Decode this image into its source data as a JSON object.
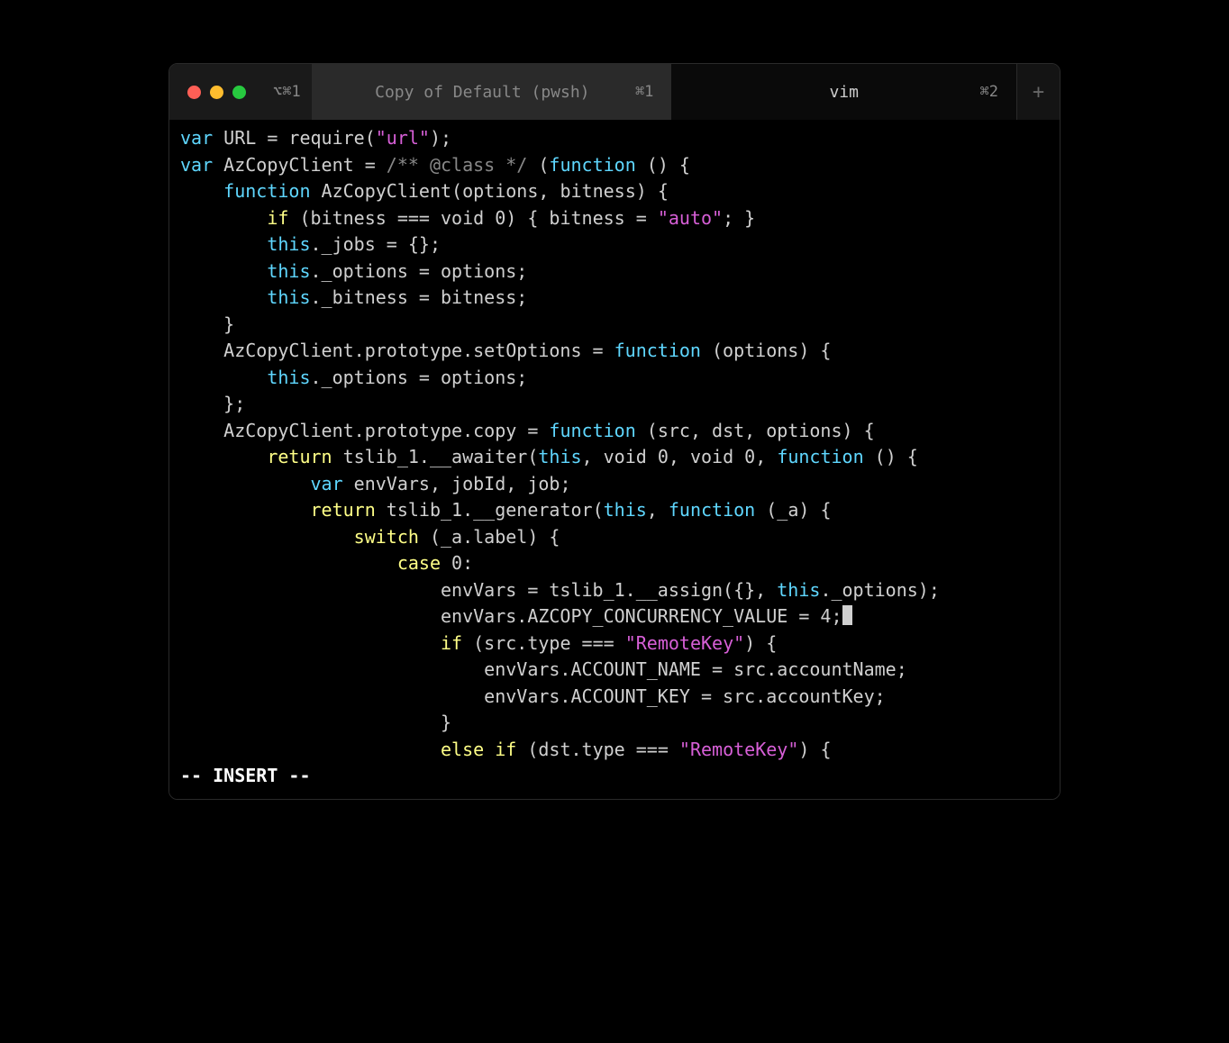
{
  "titlebar": {
    "shortcut_prefix": "⌥⌘1",
    "tabs": [
      {
        "label": "Copy of Default (pwsh)",
        "shortcut": "⌘1",
        "active": true
      },
      {
        "label": "vim",
        "shortcut": "⌘2",
        "active": false
      }
    ],
    "new_tab_symbol": "+"
  },
  "code": {
    "lines": [
      [
        {
          "t": "var",
          "c": "kw-var"
        },
        {
          "t": " URL = require(",
          "c": "ident"
        },
        {
          "t": "\"url\"",
          "c": "str"
        },
        {
          "t": ");",
          "c": "punct"
        }
      ],
      [
        {
          "t": "var",
          "c": "kw-var"
        },
        {
          "t": " AzCopyClient = ",
          "c": "ident"
        },
        {
          "t": "/** @class */",
          "c": "comment"
        },
        {
          "t": " (",
          "c": "punct"
        },
        {
          "t": "function",
          "c": "kw-func"
        },
        {
          "t": " () {",
          "c": "punct"
        }
      ],
      [
        {
          "t": "    ",
          "c": "ident"
        },
        {
          "t": "function",
          "c": "kw-func"
        },
        {
          "t": " AzCopyClient(options, bitness) {",
          "c": "ident"
        }
      ],
      [
        {
          "t": "        ",
          "c": "ident"
        },
        {
          "t": "if",
          "c": "kw-ctrl"
        },
        {
          "t": " (bitness === void ",
          "c": "ident"
        },
        {
          "t": "0",
          "c": "num"
        },
        {
          "t": ") { bitness = ",
          "c": "ident"
        },
        {
          "t": "\"auto\"",
          "c": "str"
        },
        {
          "t": "; }",
          "c": "punct"
        }
      ],
      [
        {
          "t": "        ",
          "c": "ident"
        },
        {
          "t": "this",
          "c": "kw-this"
        },
        {
          "t": "._jobs = {};",
          "c": "ident"
        }
      ],
      [
        {
          "t": "        ",
          "c": "ident"
        },
        {
          "t": "this",
          "c": "kw-this"
        },
        {
          "t": "._options = options;",
          "c": "ident"
        }
      ],
      [
        {
          "t": "        ",
          "c": "ident"
        },
        {
          "t": "this",
          "c": "kw-this"
        },
        {
          "t": "._bitness = bitness;",
          "c": "ident"
        }
      ],
      [
        {
          "t": "    }",
          "c": "punct"
        }
      ],
      [
        {
          "t": "    AzCopyClient.prototype.setOptions = ",
          "c": "ident"
        },
        {
          "t": "function",
          "c": "kw-func"
        },
        {
          "t": " (options) {",
          "c": "ident"
        }
      ],
      [
        {
          "t": "        ",
          "c": "ident"
        },
        {
          "t": "this",
          "c": "kw-this"
        },
        {
          "t": "._options = options;",
          "c": "ident"
        }
      ],
      [
        {
          "t": "    };",
          "c": "punct"
        }
      ],
      [
        {
          "t": "    AzCopyClient.prototype.copy = ",
          "c": "ident"
        },
        {
          "t": "function",
          "c": "kw-func"
        },
        {
          "t": " (src, dst, options) {",
          "c": "ident"
        }
      ],
      [
        {
          "t": "        ",
          "c": "ident"
        },
        {
          "t": "return",
          "c": "kw-ctrl"
        },
        {
          "t": " tslib_1.__awaiter(",
          "c": "ident"
        },
        {
          "t": "this",
          "c": "kw-this"
        },
        {
          "t": ", void ",
          "c": "ident"
        },
        {
          "t": "0",
          "c": "num"
        },
        {
          "t": ", void ",
          "c": "ident"
        },
        {
          "t": "0",
          "c": "num"
        },
        {
          "t": ", ",
          "c": "ident"
        },
        {
          "t": "function",
          "c": "kw-func"
        },
        {
          "t": " () {",
          "c": "ident"
        }
      ],
      [
        {
          "t": "            ",
          "c": "ident"
        },
        {
          "t": "var",
          "c": "kw-var"
        },
        {
          "t": " envVars, jobId, job;",
          "c": "ident"
        }
      ],
      [
        {
          "t": "            ",
          "c": "ident"
        },
        {
          "t": "return",
          "c": "kw-ctrl"
        },
        {
          "t": " tslib_1.__generator(",
          "c": "ident"
        },
        {
          "t": "this",
          "c": "kw-this"
        },
        {
          "t": ", ",
          "c": "ident"
        },
        {
          "t": "function",
          "c": "kw-func"
        },
        {
          "t": " (_a) {",
          "c": "ident"
        }
      ],
      [
        {
          "t": "                ",
          "c": "ident"
        },
        {
          "t": "switch",
          "c": "kw-ctrl"
        },
        {
          "t": " (_a.label) {",
          "c": "ident"
        }
      ],
      [
        {
          "t": "                    ",
          "c": "ident"
        },
        {
          "t": "case",
          "c": "kw-ctrl"
        },
        {
          "t": " ",
          "c": "ident"
        },
        {
          "t": "0",
          "c": "num"
        },
        {
          "t": ":",
          "c": "punct"
        }
      ],
      [
        {
          "t": "                        envVars = tslib_1.__assign({}, ",
          "c": "ident"
        },
        {
          "t": "this",
          "c": "kw-this"
        },
        {
          "t": "._options);",
          "c": "ident"
        }
      ],
      [
        {
          "t": "                        envVars.AZCOPY_CONCURRENCY_VALUE = ",
          "c": "ident"
        },
        {
          "t": "4",
          "c": "num"
        },
        {
          "t": ";",
          "c": "punct"
        },
        {
          "t": "CURSOR",
          "c": "cursor"
        }
      ],
      [
        {
          "t": "                        ",
          "c": "ident"
        },
        {
          "t": "if",
          "c": "kw-ctrl"
        },
        {
          "t": " (src.type === ",
          "c": "ident"
        },
        {
          "t": "\"RemoteKey\"",
          "c": "str"
        },
        {
          "t": ") {",
          "c": "ident"
        }
      ],
      [
        {
          "t": "                            envVars.ACCOUNT_NAME = src.accountName;",
          "c": "ident"
        }
      ],
      [
        {
          "t": "                            envVars.ACCOUNT_KEY = src.accountKey;",
          "c": "ident"
        }
      ],
      [
        {
          "t": "                        }",
          "c": "punct"
        }
      ],
      [
        {
          "t": "                        ",
          "c": "ident"
        },
        {
          "t": "else",
          "c": "kw-ctrl"
        },
        {
          "t": " ",
          "c": "ident"
        },
        {
          "t": "if",
          "c": "kw-ctrl"
        },
        {
          "t": " (dst.type === ",
          "c": "ident"
        },
        {
          "t": "\"RemoteKey\"",
          "c": "str"
        },
        {
          "t": ") {",
          "c": "ident"
        }
      ]
    ]
  },
  "status": {
    "mode": "-- INSERT --"
  }
}
